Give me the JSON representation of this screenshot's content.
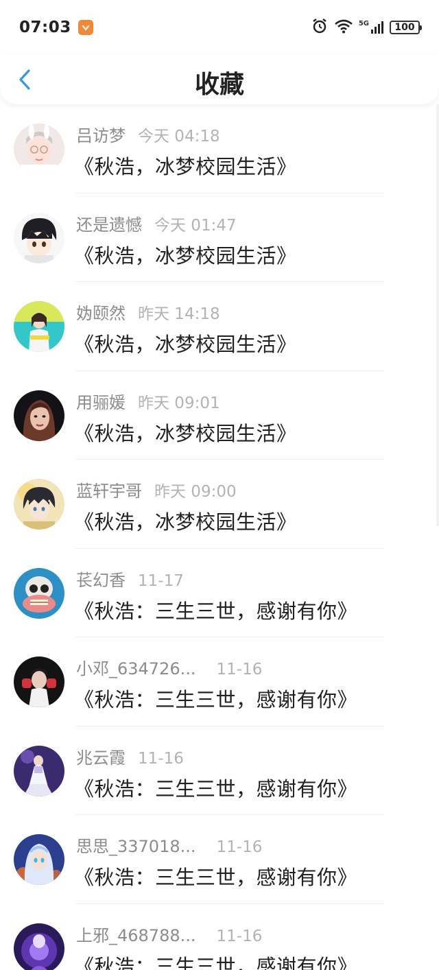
{
  "status_bar": {
    "time": "07:03",
    "battery": "100",
    "network": "5G",
    "icons": [
      "app-badge-icon",
      "alarm-icon",
      "wifi-icon",
      "signal-icon",
      "battery-icon"
    ]
  },
  "header": {
    "title": "收藏",
    "back_icon": "chevron-left-icon",
    "accent_color": "#2e9ae6"
  },
  "items": [
    {
      "user": "吕访梦",
      "time": "今天 04:18",
      "title": "《秋浩，冰梦校园生活》"
    },
    {
      "user": "还是遗憾",
      "time": "今天 01:47",
      "title": "《秋浩，冰梦校园生活》"
    },
    {
      "user": "妫颐然",
      "time": "昨天 14:18",
      "title": "《秋浩，冰梦校园生活》"
    },
    {
      "user": "用骊媛",
      "time": "昨天 09:01",
      "title": "《秋浩，冰梦校园生活》"
    },
    {
      "user": "蓝轩宇哥",
      "time": "昨天 09:00",
      "title": "《秋浩，冰梦校园生活》"
    },
    {
      "user": "苌幻香",
      "time": "11-17",
      "title": "《秋浩：三生三世，感谢有你》"
    },
    {
      "user": "小邓_634726...",
      "time": "11-16",
      "title": "《秋浩：三生三世，感谢有你》"
    },
    {
      "user": "兆云霞",
      "time": "11-16",
      "title": "《秋浩：三生三世，感谢有你》"
    },
    {
      "user": "思思_337018...",
      "time": "11-16",
      "title": "《秋浩：三生三世，感谢有你》"
    },
    {
      "user": "上邪_468788...",
      "time": "11-16",
      "title": "《秋浩：三生三世，感谢有你》"
    }
  ]
}
